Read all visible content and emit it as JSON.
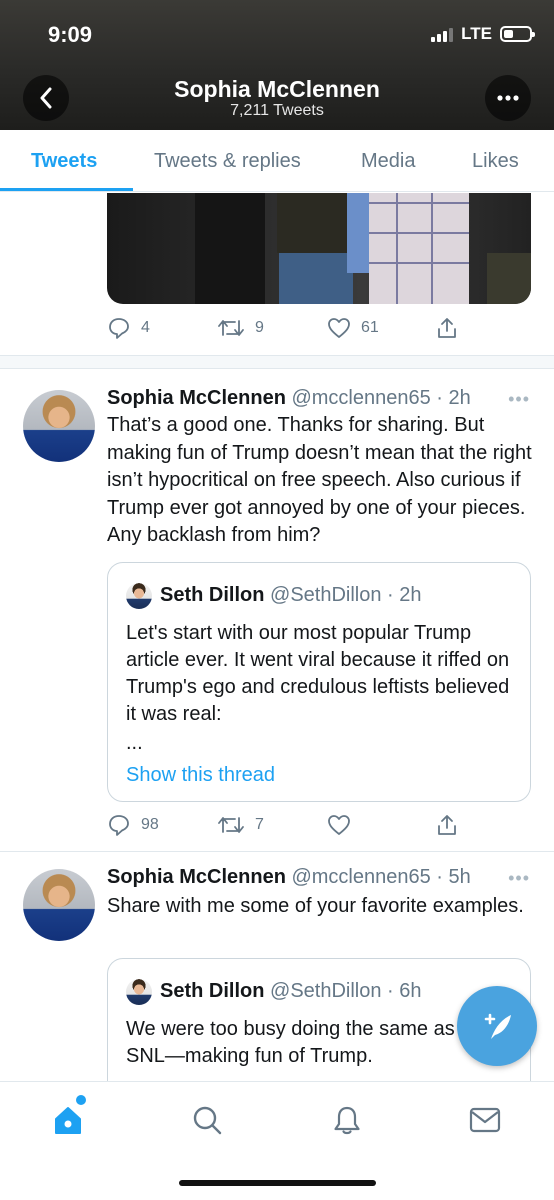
{
  "status_bar": {
    "time": "9:09",
    "network": "LTE"
  },
  "profile": {
    "name": "Sophia McClennen",
    "tweet_count": "7,211 Tweets"
  },
  "tabs": [
    {
      "label": "Tweets",
      "active": true
    },
    {
      "label": "Tweets & replies",
      "active": false
    },
    {
      "label": "Media",
      "active": false
    },
    {
      "label": "Likes",
      "active": false
    }
  ],
  "tweets": [
    {
      "replies": "4",
      "retweets": "9",
      "likes": "61"
    },
    {
      "author": "Sophia McClennen",
      "handle": "@mcclennen65",
      "time": "2h",
      "text": "That’s a good one. Thanks for sharing. But making fun of Trump doesn’t mean that the right isn’t hypocritical  on free speech. Also  curious if Trump ever got annoyed by one of your pieces. Any backlash from him?",
      "quote": {
        "author": "Seth Dillon",
        "handle": "@SethDillon",
        "time": "2h",
        "text": "Let's start with our most popular Trump article ever. It went viral because it riffed on Trump's ego and credulous leftists believed it was real:",
        "ellipsis": "...",
        "link": "Show this thread"
      },
      "replies": "98",
      "retweets": "7",
      "likes": ""
    },
    {
      "author": "Sophia McClennen",
      "handle": "@mcclennen65",
      "time": "5h",
      "text": "Share with me some of your favorite examples.",
      "quote": {
        "author": "Seth Dillon",
        "handle": "@SethDillon",
        "time": "6h",
        "text": "We were too busy doing the same as SNL—making fun of Trump."
      }
    }
  ],
  "meta_separator": " · ",
  "more_glyph": "•••",
  "colors": {
    "accent": "#1da1f2",
    "fab": "#4aa3df",
    "muted": "#657786"
  },
  "icons": {
    "back": "chevron-left-icon",
    "more": "more-horizontal-icon",
    "reply": "reply-icon",
    "retweet": "retweet-icon",
    "like": "heart-icon",
    "share": "share-icon",
    "compose": "compose-feather-icon",
    "nav": [
      "home-icon",
      "search-icon",
      "bell-icon",
      "mail-icon"
    ]
  }
}
